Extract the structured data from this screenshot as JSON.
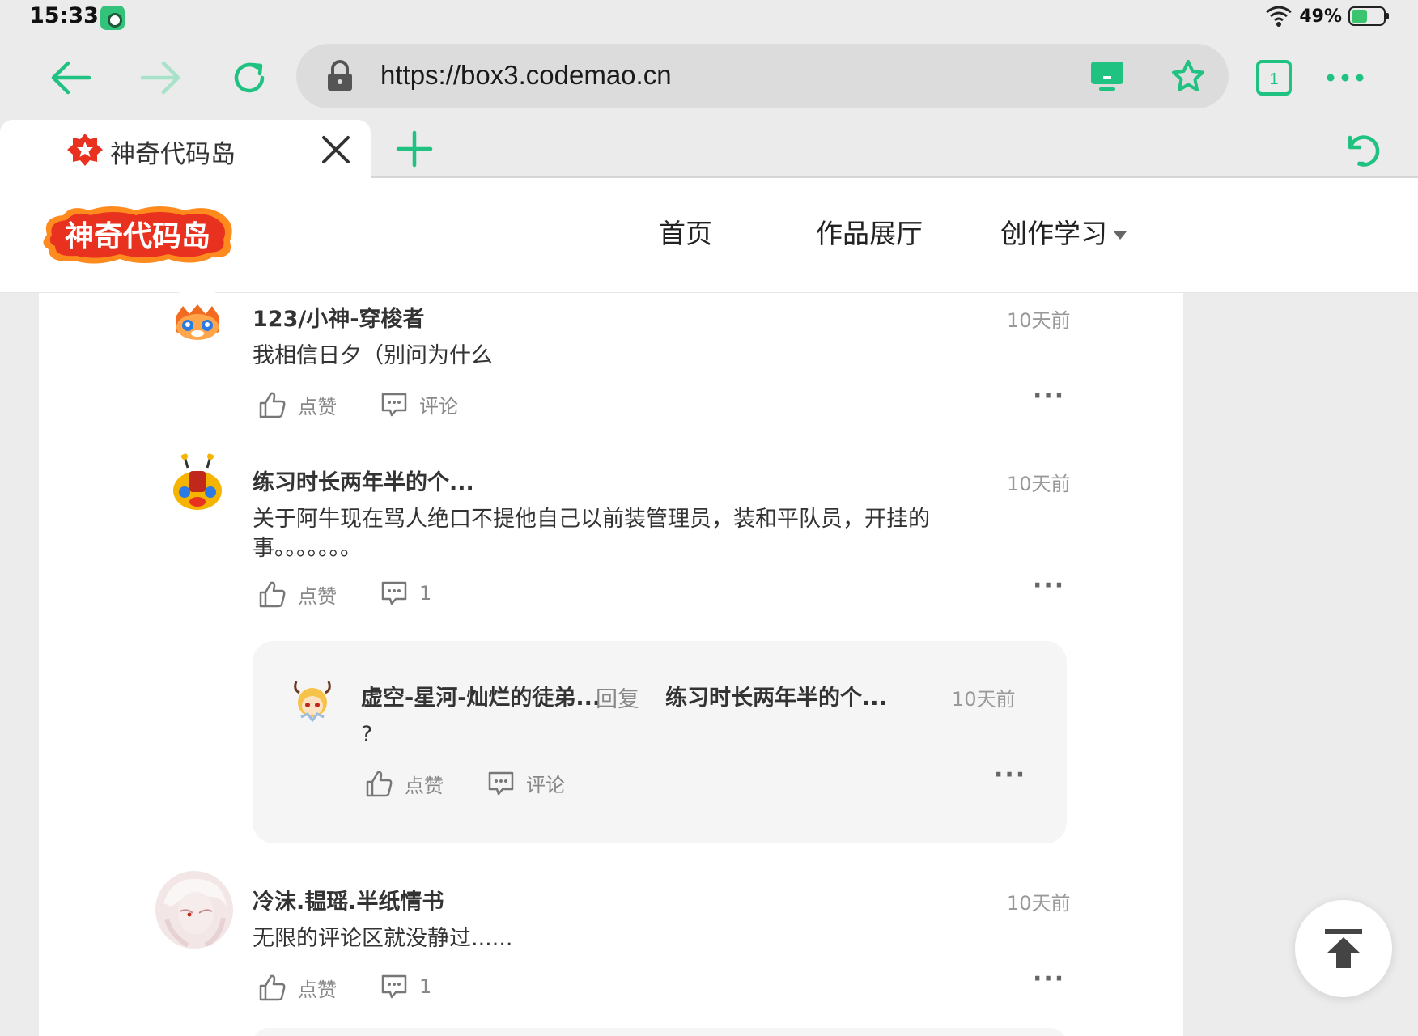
{
  "status": {
    "time": "15:33",
    "battery": "49%"
  },
  "browser": {
    "url": "https://box3.codemao.cn",
    "tab_count": "1",
    "tab_title": "神奇代码岛"
  },
  "site": {
    "logo_text": "神奇代码岛",
    "nav": {
      "home": "首页",
      "gallery": "作品展厅",
      "learn": "创作学习"
    }
  },
  "labels": {
    "like": "点赞",
    "comment": "评论",
    "reply": "回复",
    "more": "···"
  },
  "comments": [
    {
      "user": "123/小神-穿梭者",
      "time": "10天前",
      "body": "我相信日夕（别问为什么",
      "comment_label": "评论"
    },
    {
      "user": "练习时长两年半的个...",
      "time": "10天前",
      "body": "关于阿牛现在骂人绝口不提他自己以前装管理员，装和平队员，开挂的事。。。。。。。",
      "comment_label": "1",
      "reply": {
        "user": "虚空-星河-灿烂的徒弟...",
        "reply_to": "练习时长两年半的个...",
        "time": "10天前",
        "body": "?",
        "comment_label": "评论"
      }
    },
    {
      "user": "冷沫.韫瑶.半纸情书",
      "time": "10天前",
      "body": "无限的评论区就没静过......",
      "comment_label": "1"
    }
  ],
  "colors": {
    "accent": "#1fc281",
    "logo_red": "#e8321f",
    "logo_orange": "#ff8a1d"
  }
}
